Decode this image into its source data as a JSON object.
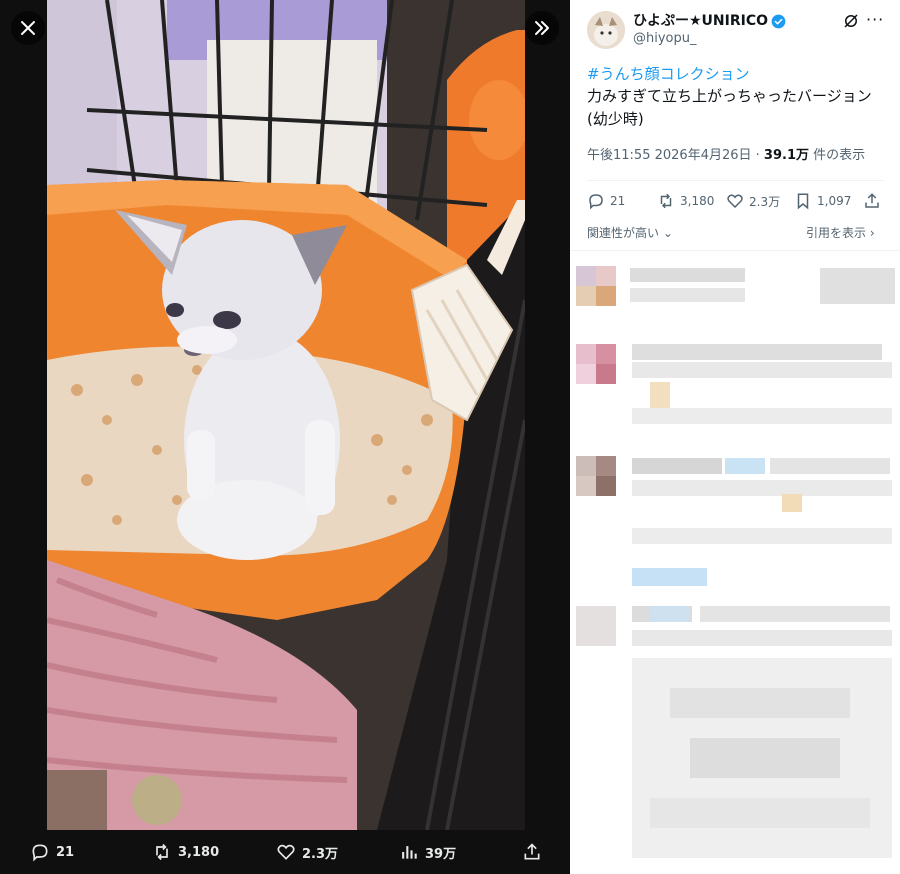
{
  "viewer": {
    "close_icon": "close-icon",
    "collapse_icon": "chevrons-right-icon",
    "actions": {
      "reply_count": "21",
      "repost_count": "3,180",
      "like_count": "2.3万",
      "view_count": "39万"
    }
  },
  "post": {
    "author": {
      "name": "ひよぷー★UNIRICO",
      "handle": "@hiyopu_",
      "verified": true
    },
    "hashtag": "#うんち顔コレクション",
    "text": "力みすぎて立ち上がっちゃったバージョン(幼少時)",
    "time": "午後11:55",
    "date": "2026年4月26日",
    "views": "39.1万",
    "views_label": "件の表示",
    "stats": {
      "replies": "21",
      "reposts": "3,180",
      "likes": "2.3万",
      "bookmarks": "1,097"
    },
    "sort_label": "関連性が高い",
    "quotes_label": "引用を表示"
  },
  "colors": {
    "accent": "#1d9bf0",
    "viewer_bg": "#0f0f0f",
    "muted_text": "#536471"
  }
}
